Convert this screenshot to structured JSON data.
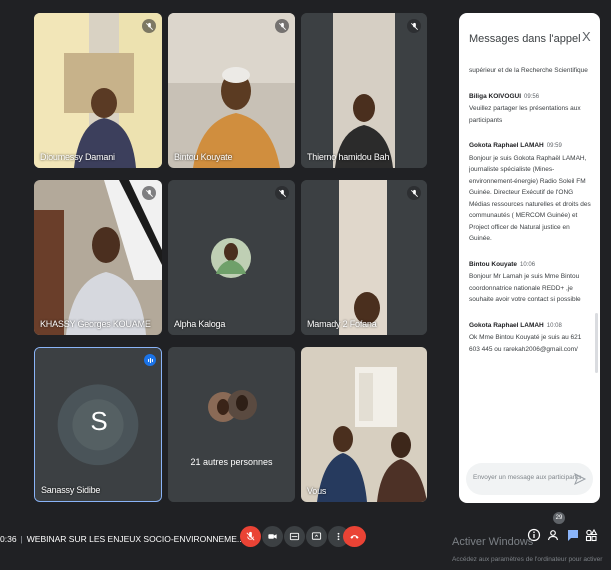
{
  "participants": [
    {
      "name": "Dioumessy Damani"
    },
    {
      "name": "Bintou Kouyate"
    },
    {
      "name": "Thierno hamidou Bah"
    },
    {
      "name": "KHASSY Georges KOUAME"
    },
    {
      "name": "Alpha Kaloga"
    },
    {
      "name": "Mamady 2 Fofana"
    },
    {
      "name": "Sanassy Sidibe",
      "initial": "S"
    },
    {
      "name": "21 autres personnes"
    },
    {
      "name": "Vous"
    }
  ],
  "chat": {
    "title": "Messages dans l'appel",
    "close": "X",
    "messages": [
      {
        "sender": "",
        "time": "",
        "text": "supérieur et de la Recherche Scientifique"
      },
      {
        "sender": "Biliga KOIVOGUI",
        "time": "09:56",
        "text": "Veuillez partager les présentations aux participants"
      },
      {
        "sender": "Gokota Raphael LAMAH",
        "time": "09:59",
        "text": "Bonjour je suis Gokota Raphaël LAMAH, journaliste spécialiste (Mines-environnement-énergie) Radio Soleil FM Guinée. Directeur Exécutif de l'ONG Médias ressources naturelles et droits des communautés ( MERCOM Guinée) et Project officer de Natural justice en Guinée."
      },
      {
        "sender": "Bintou Kouyate",
        "time": "10:06",
        "text": "Bonjour Mr Lamah je suis Mme Bintou coordonnatrice nationale REDD+ ,je souhaite avoir votre contact si possible"
      },
      {
        "sender": "Gokota Raphael LAMAH",
        "time": "10:08",
        "text": "Ok Mme Bintou Kouyaté je suis au 621 603 445 ou rarekah2006@gmail.com/"
      }
    ],
    "placeholder": "Envoyer un message aux participants"
  },
  "meeting": {
    "time": "0:36",
    "title": "WEBINAR SUR LES ENJEUX SOCIO-ENVIRONNEME..."
  },
  "people_count": "29",
  "watermark": {
    "title": "Activer Windows",
    "subtitle": "Accédez aux paramètres de l'ordinateur pour activer"
  },
  "colors": {
    "background": "#202124",
    "tile": "#3c4043",
    "danger": "#ea4335",
    "accent": "#8ab4f8"
  }
}
